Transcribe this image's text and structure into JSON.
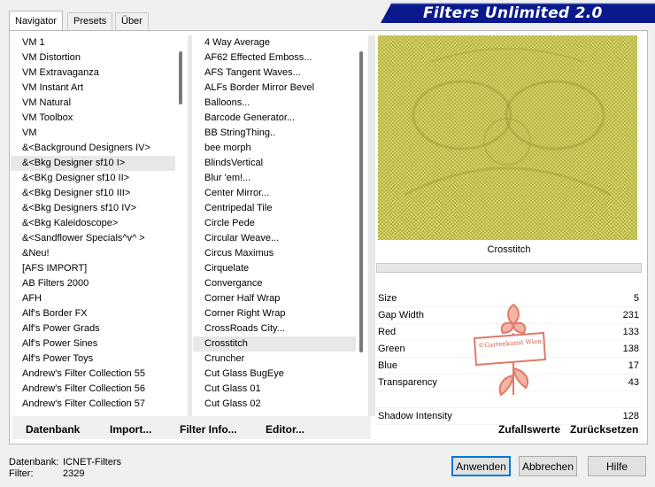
{
  "tabs": [
    "Navigator",
    "Presets",
    "Über"
  ],
  "app_title": "Filters Unlimited 2.0",
  "categories": [
    "VM 1",
    "VM Distortion",
    "VM Extravaganza",
    "VM Instant Art",
    "VM Natural",
    "VM Toolbox",
    "VM",
    "&<Background Designers IV>",
    "&<Bkg Designer sf10 I>",
    "&<BKg Designer sf10 II>",
    "&<Bkg Designer sf10 III>",
    "&<Bkg Designers sf10 IV>",
    "&<Bkg Kaleidoscope>",
    "&<Sandflower Specials^v^ >",
    "&Neu!",
    "[AFS IMPORT]",
    "AB Filters 2000",
    "AFH",
    "Alf's Border FX",
    "Alf's Power Grads",
    "Alf's Power Sines",
    "Alf's Power Toys",
    "Andrew's Filter Collection 55",
    "Andrew's Filter Collection 56",
    "Andrew's Filter Collection 57"
  ],
  "selected_category": "&<Bkg Designer sf10 I>",
  "filters": [
    "4 Way Average",
    "AF62 Effected Emboss...",
    "AFS Tangent Waves...",
    "ALFs Border Mirror Bevel",
    "Balloons...",
    "Barcode Generator...",
    "BB StringThing..",
    "bee morph",
    "BlindsVertical",
    "Blur 'em!...",
    "Center Mirror...",
    "Centripedal Tile",
    "Circle Pede",
    "Circular Weave...",
    "Circus Maximus",
    "Cirquelate",
    "Convergance",
    "Corner Half Wrap",
    "Corner Right Wrap",
    "CrossRoads City...",
    "Crosstitch",
    "Cruncher",
    "Cut Glass  BugEye",
    "Cut Glass 01",
    "Cut Glass 02"
  ],
  "selected_filter": "Crosstitch",
  "current_filter_name": "Crosstitch",
  "preview_progress": 0,
  "params": [
    {
      "label": "Size",
      "value": "5"
    },
    {
      "label": "Gap Width",
      "value": "231"
    },
    {
      "label": "Red",
      "value": "133"
    },
    {
      "label": "Green",
      "value": "138"
    },
    {
      "label": "Blue",
      "value": "17"
    },
    {
      "label": "Transparency",
      "value": "43"
    },
    {
      "label": "",
      "value": ""
    },
    {
      "label": "Shadow Intensity",
      "value": "128"
    }
  ],
  "actions": {
    "database": "Datenbank",
    "import": "Import...",
    "filter_info": "Filter Info...",
    "editor": "Editor...",
    "random": "Zufallswerte",
    "reset": "Zurücksetzen"
  },
  "status": {
    "db_label": "Datenbank:",
    "db_value": "ICNET-Filters",
    "filter_label": "Filter:",
    "filter_value": "2329"
  },
  "buttons": {
    "apply": "Anwenden",
    "cancel": "Abbrechen",
    "help": "Hilfe"
  },
  "watermark": "©Gartenkunst Wien",
  "colors": {
    "banner": "#0a1a8c",
    "preview": "#c4c24a",
    "accent": "#0078d7",
    "logo": "#e89a8a"
  }
}
